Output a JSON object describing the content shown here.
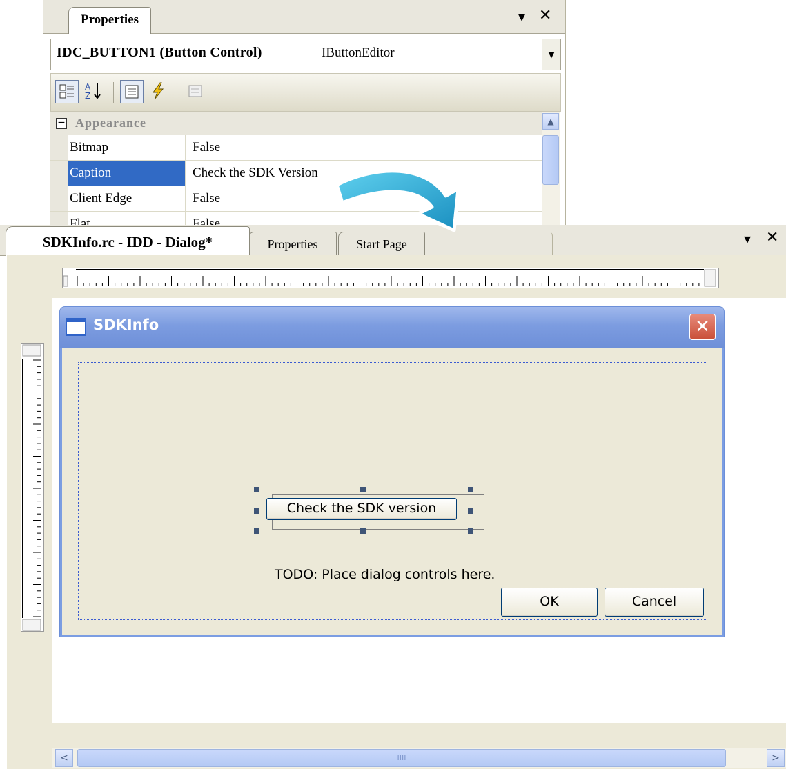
{
  "properties_panel": {
    "tab_label": "Properties",
    "pin_glyph": "▾",
    "close_glyph": "✕",
    "object_name": "IDC_BUTTON1 (Button Control)",
    "object_type": "IButtonEditor",
    "toolbar_icons": [
      "categorized-icon",
      "alphabetical-icon",
      "properties-icon",
      "events-icon",
      "property-pages-icon"
    ],
    "category": {
      "toggle": "−",
      "label": "Appearance"
    },
    "rows": [
      {
        "name": "Bitmap",
        "value": "False"
      },
      {
        "name": "Caption",
        "value": "Check the SDK Version",
        "selected": true
      },
      {
        "name": "Client Edge",
        "value": "False"
      },
      {
        "name": "Flat",
        "value": "False"
      }
    ]
  },
  "editor": {
    "tabs": [
      {
        "label": "SDKInfo.rc - IDD - Dialog*",
        "active": true
      },
      {
        "label": "Properties"
      },
      {
        "label": "Start Page"
      }
    ],
    "pin_glyph": "▾",
    "close_glyph": "✕"
  },
  "dialog": {
    "title": "SDKInfo",
    "close_glyph": "✕",
    "selected_button_label": "Check the SDK version",
    "todo_text": "TODO: Place dialog controls here.",
    "ok_label": "OK",
    "cancel_label": "Cancel"
  },
  "scrollbar": {
    "left_glyph": "<",
    "right_glyph": ">",
    "thumb_grip": "IIII"
  },
  "colors": {
    "selection": "#316ac5",
    "titlebar": "#7c9ce0",
    "arrow": "#2fb3d9"
  }
}
